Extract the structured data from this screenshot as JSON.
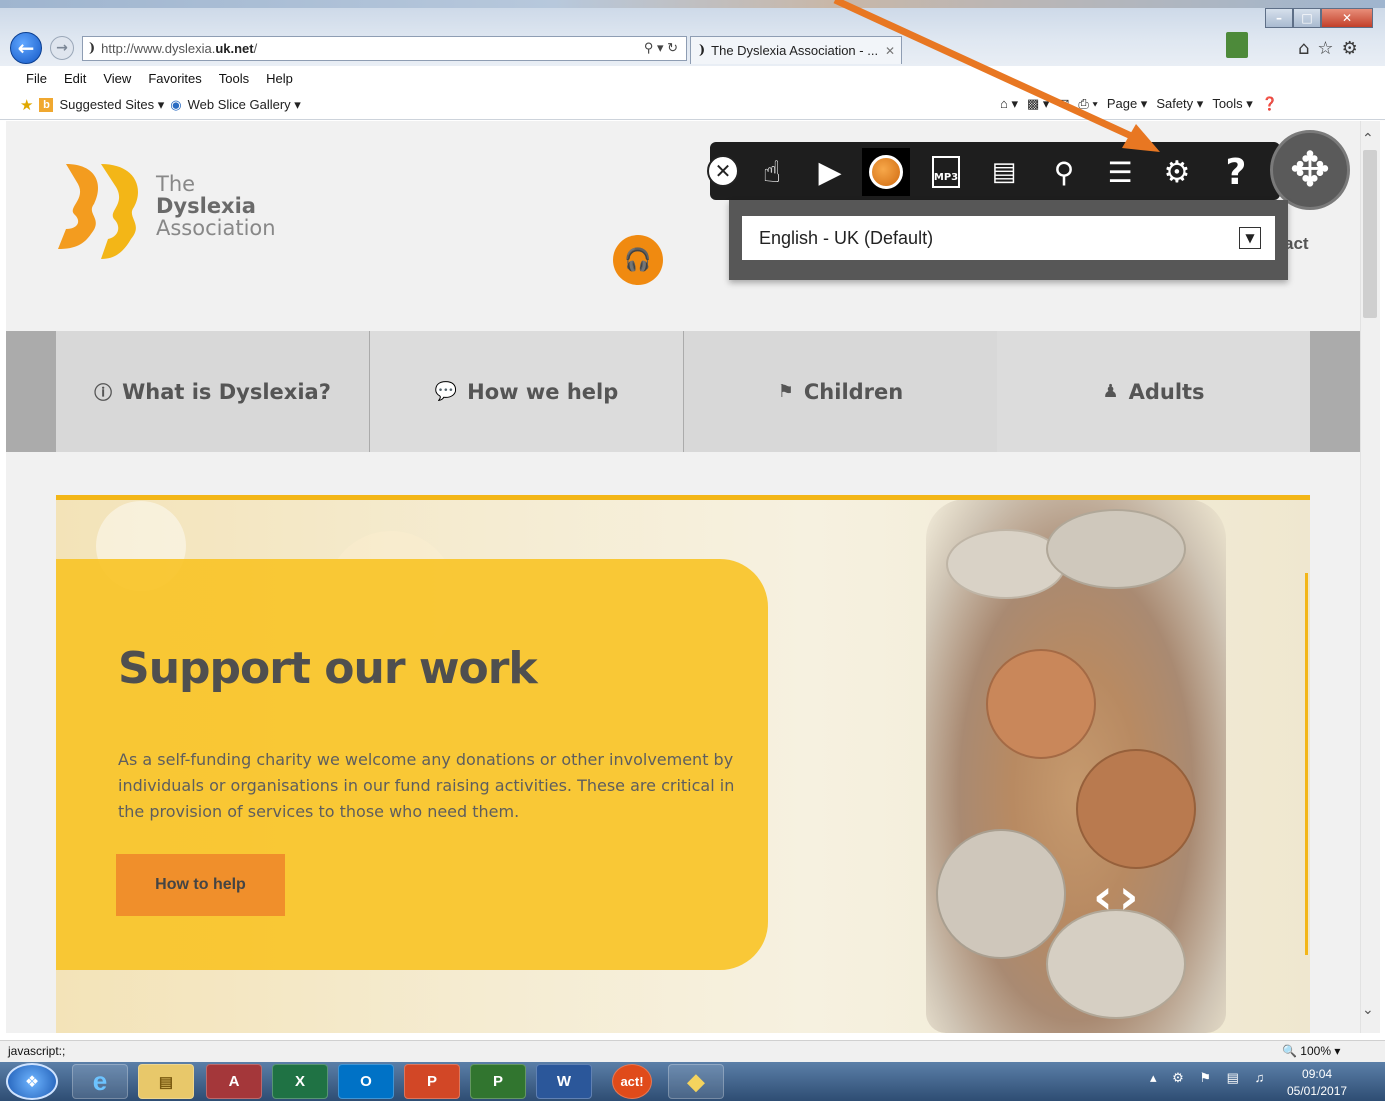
{
  "browser": {
    "url_prefix": "http://www.dyslexia.",
    "url_domain": "uk.net",
    "url_suffix": "/",
    "tab_title": "The Dyslexia Association - ...",
    "menu": [
      "File",
      "Edit",
      "View",
      "Favorites",
      "Tools",
      "Help"
    ],
    "fav_suggested": "Suggested Sites ▾",
    "fav_webslice": "Web Slice Gallery ▾",
    "cmd_page": "Page ▾",
    "cmd_safety": "Safety ▾",
    "cmd_tools": "Tools ▾",
    "status_text": "javascript:;",
    "zoom": "100%"
  },
  "site": {
    "brand_line1": "The",
    "brand_line2": "Dyslexia",
    "brand_line3": "Association",
    "contact_partial": "act",
    "nav": [
      {
        "label": "What is Dyslexia?",
        "icon": "info-circle-icon"
      },
      {
        "label": "How we help",
        "icon": "comments-icon"
      },
      {
        "label": "Children",
        "icon": "child-icon"
      },
      {
        "label": "Adults",
        "icon": "person-icon"
      }
    ],
    "hero_title": "Support our work",
    "hero_body": "As a self-funding charity we welcome any donations or other involvement by individuals or organisations in our fund raising activities. These are critical in the provision of services to those who need them.",
    "hero_button": "How to help"
  },
  "toolbar": {
    "language_selected": "English - UK (Default)",
    "mp3_label": "MP3",
    "help_label": "?",
    "accent_color": "#f08a10"
  },
  "taskbar": {
    "time": "09:04",
    "date": "05/01/2017",
    "app_labels": [
      "A",
      "X",
      "O",
      "P",
      "P",
      "W",
      "act!"
    ]
  },
  "annotation": {
    "arrow_color": "#e87722"
  }
}
